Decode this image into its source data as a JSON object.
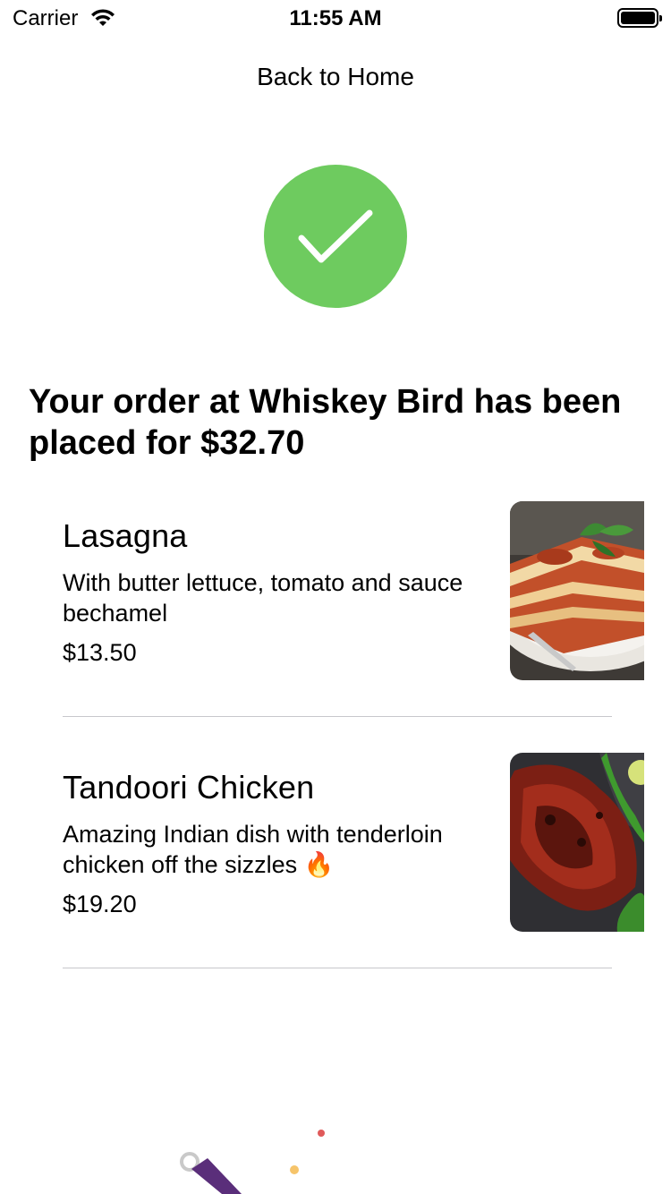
{
  "status_bar": {
    "carrier": "Carrier",
    "time": "11:55 AM",
    "wifi_icon": "wifi-icon",
    "battery_icon": "battery-icon"
  },
  "nav": {
    "back_label": "Back to Home"
  },
  "confirmation": {
    "icon": "checkmark-icon",
    "accent_color": "#6ecb5f",
    "headline": "Your order at Whiskey Bird has been placed for $32.70"
  },
  "order_items": [
    {
      "name": "Lasagna",
      "description": "With butter lettuce, tomato and sauce bechamel",
      "price": "$13.50"
    },
    {
      "name": "Tandoori Chicken",
      "description": "Amazing Indian dish with tenderloin chicken off the sizzles 🔥",
      "price": "$19.20"
    }
  ]
}
